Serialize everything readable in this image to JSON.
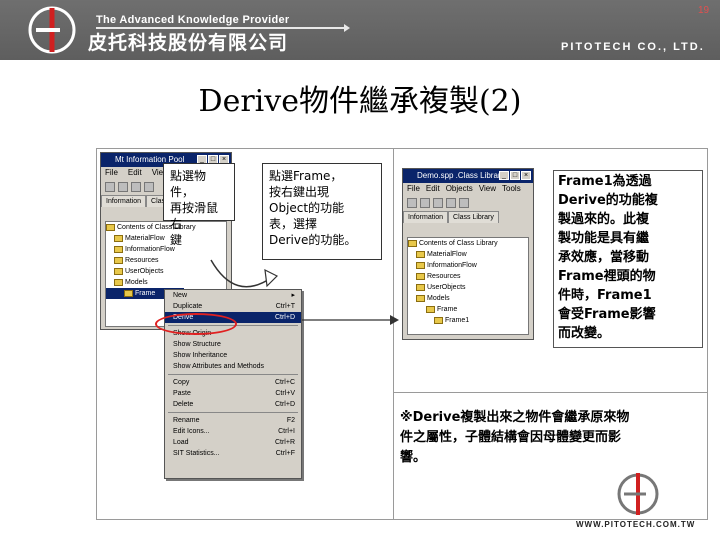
{
  "header": {
    "tagline": "The Advanced Knowledge Provider",
    "company_cn": "皮托科技股份有限公司",
    "company_en": "PITOTECH CO., LTD.",
    "page_number": "19",
    "background_color": "#666666"
  },
  "title": "Derive物件繼承複製(2)",
  "callout_1": {
    "line1": "點選物件，",
    "line2": "再按滑鼠右",
    "line3": "鍵"
  },
  "callout_2": {
    "line1": "點選Frame，",
    "line2": "按右鍵出現",
    "line3": "Object的功能",
    "line4": "表，選擇",
    "line5": "Derive的功能。"
  },
  "left_window": {
    "title": "Mt Information Pool",
    "menu": [
      "File",
      "Edit",
      "View"
    ],
    "tabs": [
      "Information",
      "Class Library"
    ],
    "tree": [
      "Contents of Class Library",
      "MaterialFlow",
      "InformationFlow",
      "Resources",
      "UserObjects",
      "Models",
      "Frame"
    ]
  },
  "context_menu": {
    "items": [
      {
        "label": "New",
        "shortcut": "▸"
      },
      {
        "label": "Duplicate",
        "shortcut": "Ctrl+T"
      },
      {
        "label": "Derive",
        "shortcut": "Ctrl+D",
        "selected": true
      },
      {
        "label": "Show Origin",
        "shortcut": ""
      },
      {
        "label": "Show Structure",
        "shortcut": ""
      },
      {
        "label": "Show Inheritance",
        "shortcut": ""
      },
      {
        "label": "Show Attributes and Methods",
        "shortcut": ""
      },
      {
        "label": "Copy",
        "shortcut": "Ctrl+C"
      },
      {
        "label": "Paste",
        "shortcut": "Ctrl+V"
      },
      {
        "label": "Delete",
        "shortcut": "Ctrl+D"
      },
      {
        "label": "Rename",
        "shortcut": "F2"
      },
      {
        "label": "Edit Icons...",
        "shortcut": "Ctrl+I"
      },
      {
        "label": "Load",
        "shortcut": "Ctrl+R"
      },
      {
        "label": "SIT Statistics...",
        "shortcut": "Ctrl+F"
      }
    ]
  },
  "right_window": {
    "title": "Demo.spp .Class Library",
    "menu": [
      "File",
      "Edit",
      "Objects",
      "View",
      "Tools"
    ],
    "tabs": [
      "Information",
      "Class Library"
    ],
    "tree": [
      "Contents of Class Library",
      "MaterialFlow",
      "InformationFlow",
      "Resources",
      "UserObjects",
      "Models",
      "Frame",
      "Frame1"
    ]
  },
  "explanation": {
    "lines": [
      "Frame1為透過",
      "Derive的功能複",
      "製過來的。此複",
      "製功能是具有繼",
      "承效應，當移動",
      "Frame裡頭的物",
      "件時，Frame1",
      "會受Frame影響",
      "而改變。"
    ]
  },
  "note": {
    "lines": [
      "※Derive複製出來之物件會繼承原來物",
      "件之屬性，子體結構會因母體變更而影",
      "響。"
    ]
  },
  "footer_url": "WWW.PITOTECH.COM.TW",
  "colors": {
    "accent_red": "#e02020",
    "selection_blue": "#0a246a"
  }
}
